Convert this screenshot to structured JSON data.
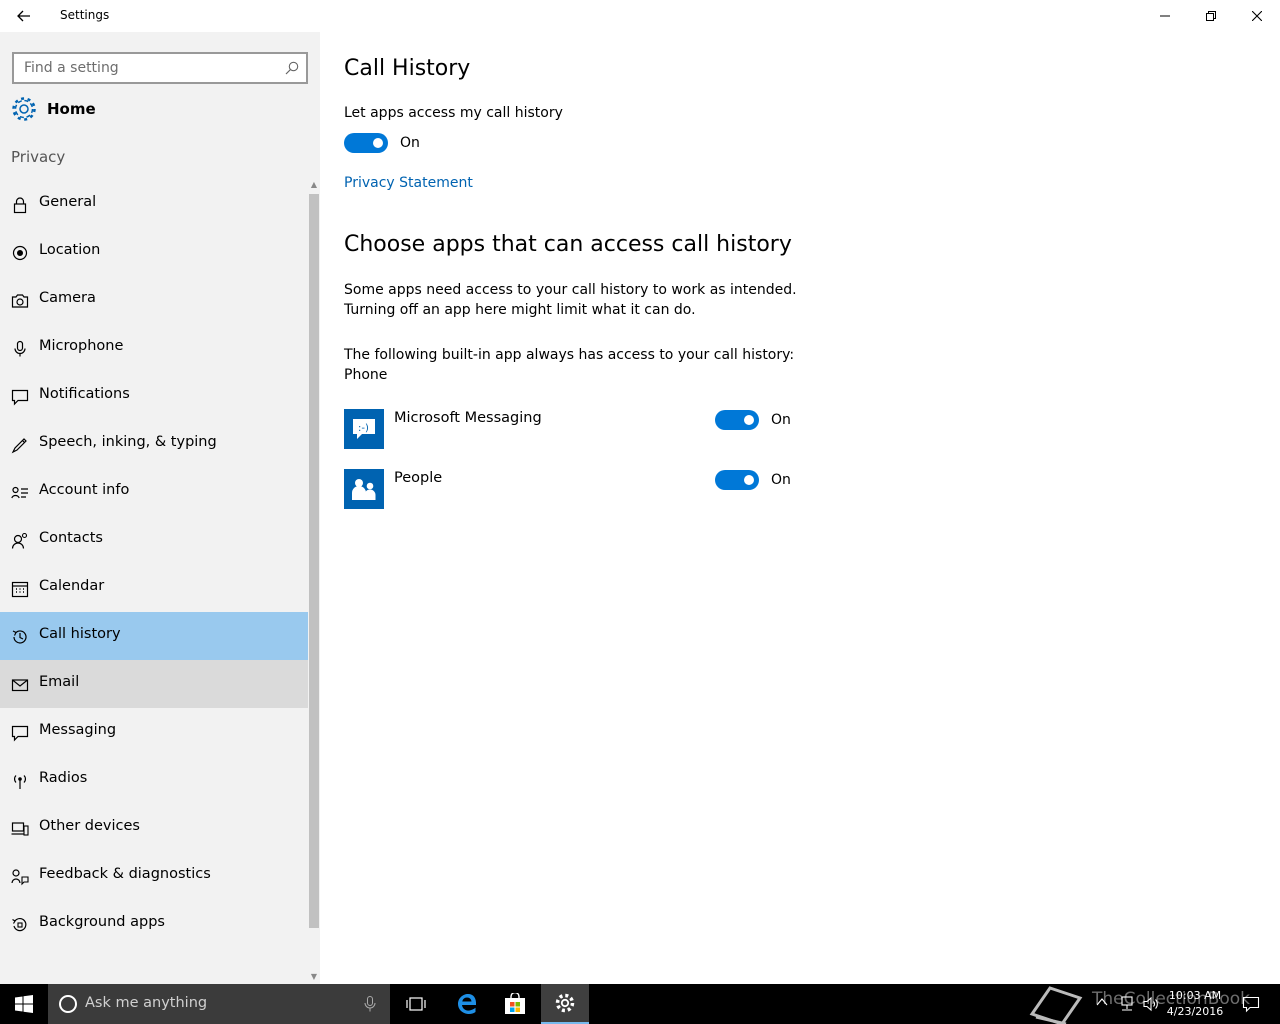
{
  "window": {
    "title": "Settings"
  },
  "sidebar": {
    "search_placeholder": "Find a setting",
    "home_label": "Home",
    "section_label": "Privacy",
    "items": [
      {
        "label": "General",
        "icon": "lock-icon"
      },
      {
        "label": "Location",
        "icon": "location-icon"
      },
      {
        "label": "Camera",
        "icon": "camera-icon"
      },
      {
        "label": "Microphone",
        "icon": "microphone-icon"
      },
      {
        "label": "Notifications",
        "icon": "notifications-icon"
      },
      {
        "label": "Speech, inking, & typing",
        "icon": "speech-icon"
      },
      {
        "label": "Account info",
        "icon": "account-info-icon"
      },
      {
        "label": "Contacts",
        "icon": "contacts-icon"
      },
      {
        "label": "Calendar",
        "icon": "calendar-icon"
      },
      {
        "label": "Call history",
        "icon": "call-history-icon"
      },
      {
        "label": "Email",
        "icon": "email-icon"
      },
      {
        "label": "Messaging",
        "icon": "messaging-icon"
      },
      {
        "label": "Radios",
        "icon": "radios-icon"
      },
      {
        "label": "Other devices",
        "icon": "other-devices-icon"
      },
      {
        "label": "Feedback & diagnostics",
        "icon": "feedback-icon"
      },
      {
        "label": "Background apps",
        "icon": "background-apps-icon"
      }
    ]
  },
  "main": {
    "title": "Call History",
    "access_label": "Let apps access my call history",
    "access_state": "On",
    "privacy_link": "Privacy Statement",
    "section_title": "Choose apps that can access call history",
    "description_line1": "Some apps need access to your call history to work as intended.",
    "description_line2": "Turning off an app here might limit what it can do.",
    "builtin_line1": "The following built-in app always has access to your call history:",
    "builtin_line2": "Phone",
    "apps": [
      {
        "name": "Microsoft Messaging",
        "state": "On"
      },
      {
        "name": "People",
        "state": "On"
      }
    ]
  },
  "taskbar": {
    "search_placeholder": "Ask me anything",
    "time": "10:03 AM",
    "date": "4/23/2016",
    "watermark": "TheCollectionBook"
  },
  "colors": {
    "accent": "#0078d7",
    "link": "#0063b1",
    "selected_nav": "#99c9ee",
    "sidebar_bg": "#f2f2f2"
  }
}
